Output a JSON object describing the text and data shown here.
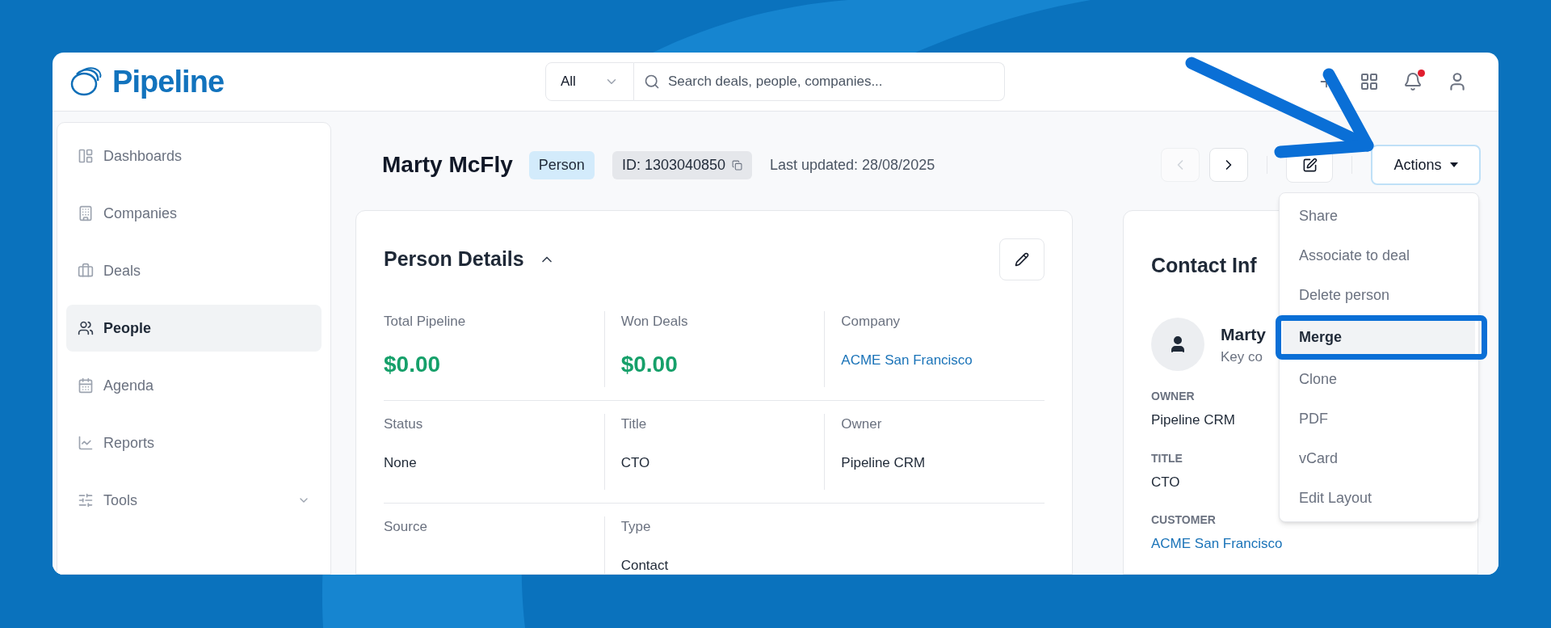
{
  "app": {
    "logo": "Pipeline"
  },
  "search": {
    "scope": "All",
    "placeholder": "Search deals, people, companies..."
  },
  "notifications": {
    "unread": true
  },
  "sidebar": {
    "items": [
      {
        "label": "Dashboards",
        "selected": false,
        "expandable": false
      },
      {
        "label": "Companies",
        "selected": false,
        "expandable": false
      },
      {
        "label": "Deals",
        "selected": false,
        "expandable": false
      },
      {
        "label": "People",
        "selected": true,
        "expandable": false
      },
      {
        "label": "Agenda",
        "selected": false,
        "expandable": false
      },
      {
        "label": "Reports",
        "selected": false,
        "expandable": false
      },
      {
        "label": "Tools",
        "selected": false,
        "expandable": true
      }
    ]
  },
  "record": {
    "name": "Marty McFly",
    "type_badge": "Person",
    "id": "ID: 1303040850",
    "last_updated": "Last updated: 28/08/2025"
  },
  "nav_buttons": [
    {
      "kind": "previous",
      "disabled": true
    },
    {
      "kind": "next",
      "disabled": false
    }
  ],
  "actions_button": {
    "label": "Actions",
    "expanded": true
  },
  "person_details": {
    "title": "Person Details",
    "expanded": true,
    "fields": [
      {
        "label": "Total Pipeline",
        "value": "$0.00",
        "kind": "money"
      },
      {
        "label": "Won Deals",
        "value": "$0.00",
        "kind": "money"
      },
      {
        "label": "Company",
        "value": "ACME San Francisco",
        "kind": "link"
      },
      {
        "label": "Status",
        "value": "None",
        "kind": "text"
      },
      {
        "label": "Title",
        "value": "CTO",
        "kind": "text"
      },
      {
        "label": "Owner",
        "value": "Pipeline CRM",
        "kind": "text"
      },
      {
        "label": "Source"
      },
      {
        "label": "Type",
        "value": "Contact",
        "kind": "text"
      }
    ]
  },
  "contact_info": {
    "title": "Contact Inf",
    "name": "Marty",
    "subtitle": "Key co",
    "fields": [
      {
        "label": "OWNER",
        "value": "Pipeline CRM",
        "kind": "text"
      },
      {
        "label": "TITLE",
        "value": "CTO",
        "kind": "text"
      },
      {
        "label": "CUSTOMER",
        "value": "ACME San Francisco",
        "kind": "link"
      }
    ]
  },
  "actions_menu": {
    "items": [
      {
        "label": "Share",
        "selected": false
      },
      {
        "label": "Associate to deal",
        "selected": false
      },
      {
        "label": "Delete person",
        "selected": false
      },
      {
        "label": "Merge",
        "selected": true
      },
      {
        "label": "Clone",
        "selected": false
      },
      {
        "label": "PDF",
        "selected": false
      },
      {
        "label": "vCard",
        "selected": false
      },
      {
        "label": "Edit Layout",
        "selected": false
      }
    ]
  }
}
